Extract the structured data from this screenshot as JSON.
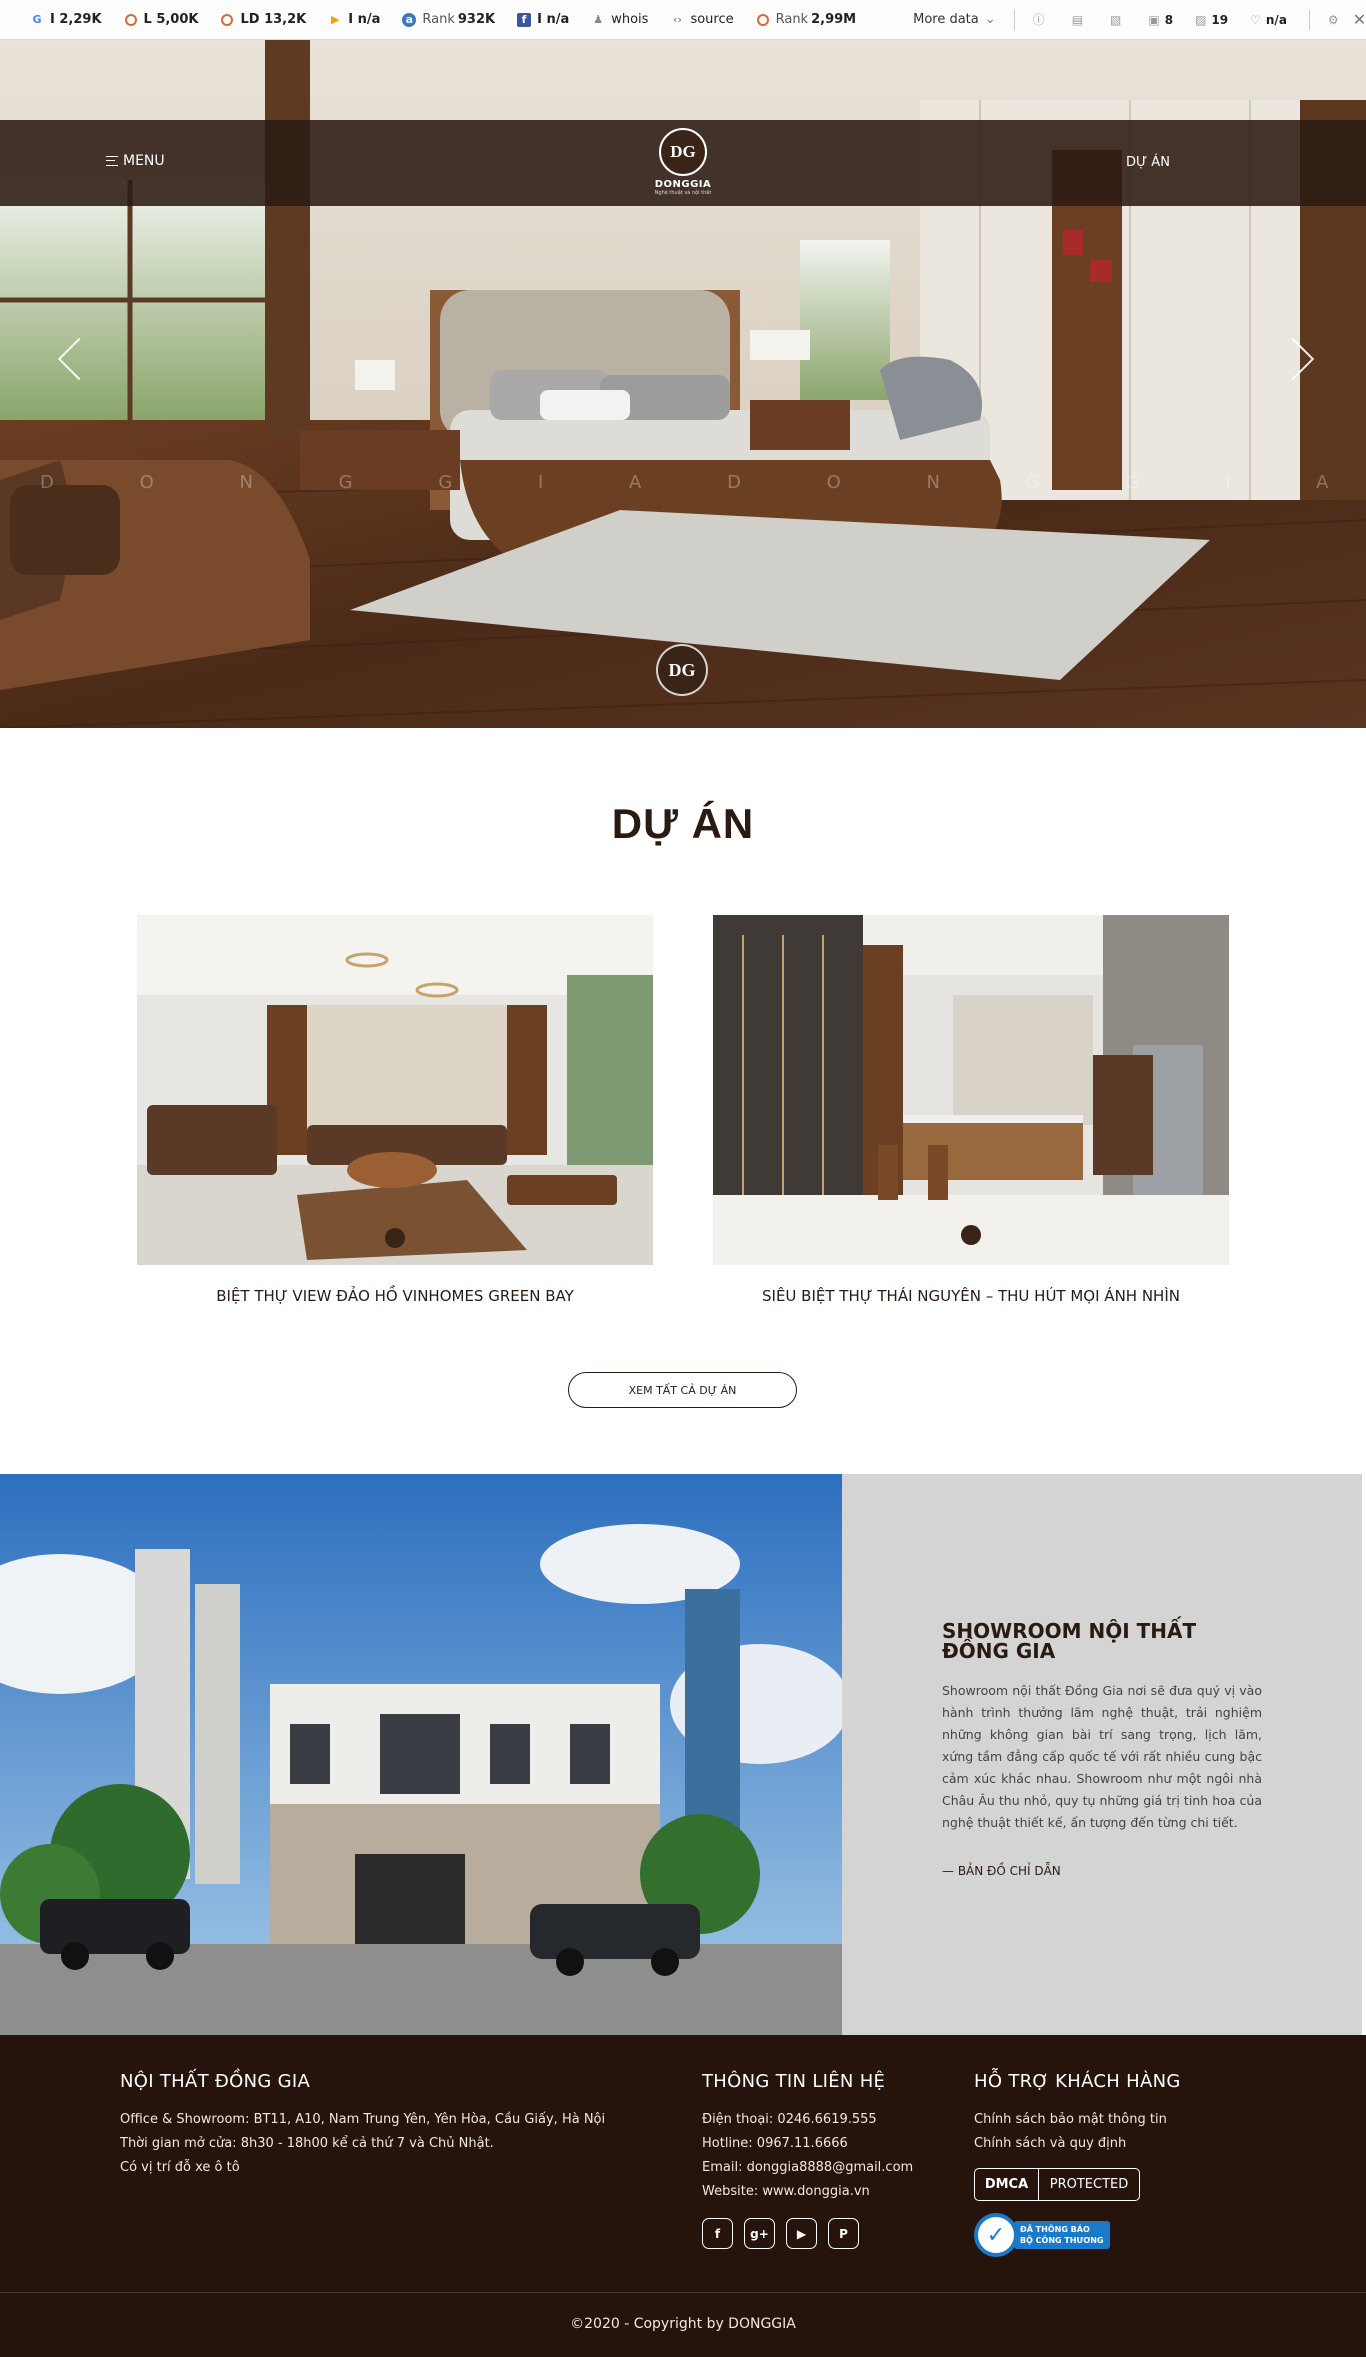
{
  "toolbar": {
    "items": [
      {
        "icon": "google-icon",
        "label": "",
        "value": "I 2,29K"
      },
      {
        "icon": "circle-icon",
        "label": "",
        "value": "L 5,00K"
      },
      {
        "icon": "circle-icon",
        "label": "",
        "value": "LD 13,2K"
      },
      {
        "icon": "bing-icon",
        "label": "",
        "value": "I n/a"
      },
      {
        "icon": "rank-icon",
        "label": "Rank",
        "value": "932K"
      },
      {
        "icon": "facebook-icon",
        "label": "",
        "value": "I n/a"
      },
      {
        "icon": "whois-icon",
        "label": "",
        "value": "whois"
      },
      {
        "icon": "code-icon",
        "label": "",
        "value": "source"
      },
      {
        "icon": "circle-icon",
        "label": "Rank",
        "value": "2,99M"
      }
    ],
    "more_data": "More data",
    "mini": [
      {
        "icon": "info-icon",
        "value": ""
      },
      {
        "icon": "page-icon",
        "value": ""
      },
      {
        "icon": "image-icon",
        "value": ""
      },
      {
        "icon": "link-icon",
        "value": "8"
      },
      {
        "icon": "image-count-icon",
        "value": "19"
      },
      {
        "icon": "heart-icon",
        "value": "n/a"
      }
    ]
  },
  "nav": {
    "menu_label": "MENU",
    "logo_initials": "DG",
    "brand": "DONGGIA",
    "tagline": "Nghệ thuật và nội thất",
    "link": "DỰ ÁN"
  },
  "hero": {
    "watermark": "D O N G G I A     D O N G G I A     D O N G G I A",
    "badge": "DG"
  },
  "projects": {
    "title": "DỰ ÁN",
    "items": [
      {
        "caption": "BIỆT THỰ VIEW ĐẢO HỒ VINHOMES GREEN BAY"
      },
      {
        "caption": "SIÊU BIỆT THỰ THÁI NGUYÊN – THU HÚT MỌI ÁNH NHÌN"
      }
    ],
    "view_all": "XEM TẤT CẢ DỰ ÁN"
  },
  "showroom": {
    "title": "SHOWROOM NỘI THẤT ĐỒNG GIA",
    "text": "Showroom nội thất Đồng Gia nơi sẽ đưa quý vị vào hành trình thưởng lãm nghệ thuật, trải nghiệm những không gian bài trí sang trọng, lịch lãm, xứng tầm đẳng cấp quốc tế với rất nhiều cung bậc cảm xúc khác nhau. Showroom như một ngôi nhà Châu Âu thu nhỏ, quy tụ những giá trị tinh hoa của nghệ thuật thiết kế, ấn tượng đến từng chi tiết.",
    "map_link": "— BẢN ĐỒ CHỈ DẪN"
  },
  "footer": {
    "col1": {
      "title": "NỘI THẤT ĐỒNG GIA",
      "lines": [
        "Office & Showroom: BT11, A10, Nam Trung Yên, Yên Hòa, Cầu Giấy, Hà Nội",
        "Thời gian mở cửa: 8h30 - 18h00 kể cả thứ 7 và Chủ Nhật.",
        "Có vị trí đỗ xe ô tô"
      ]
    },
    "col2": {
      "title": "THÔNG TIN LIÊN HỆ",
      "lines": [
        "Điện thoại: 0246.6619.555",
        "Hotline: 0967.11.6666",
        "Email: donggia8888@gmail.com",
        "Website: www.donggia.vn"
      ],
      "socials": [
        "f",
        "g+",
        "▶",
        "P"
      ]
    },
    "col3": {
      "title": "HỖ TRỢ KHÁCH HÀNG",
      "lines": [
        "Chính sách bảo mật thông tin",
        "Chính sách và quy định"
      ],
      "dmca_left": "DMCA",
      "dmca_right": "PROTECTED",
      "bct_line1": "ĐÃ THÔNG BÁO",
      "bct_line2": "BỘ CÔNG THƯƠNG"
    },
    "copyright": "©2020 - Copyright by DONGGIA"
  },
  "colors": {
    "brand_dark": "#26140c",
    "navbar": "#2b1a12",
    "showroom_panel": "#d4d4d4",
    "bct_blue": "#1b79c9"
  }
}
